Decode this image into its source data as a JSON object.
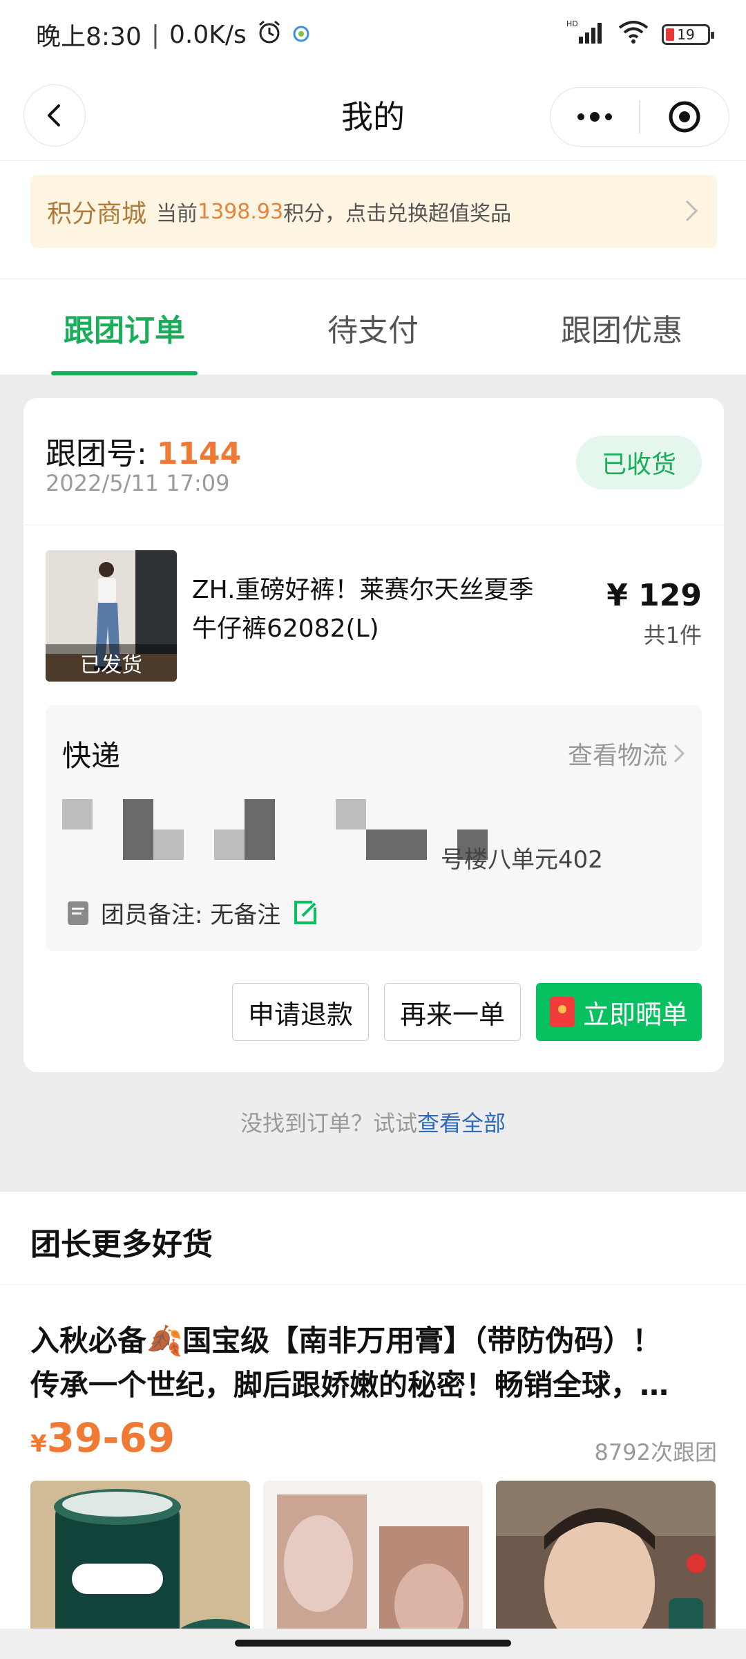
{
  "status_bar": {
    "time": "晚上8:30",
    "speed": "0.0K/s",
    "network": "HD",
    "battery": "19"
  },
  "nav": {
    "title": "我的"
  },
  "points": {
    "title": "积分商城",
    "prefix": "当前",
    "value": "1398.93",
    "suffix": "积分，点击兑换超值奖品"
  },
  "tabs": [
    {
      "label": "跟团订单",
      "active": true
    },
    {
      "label": "待支付",
      "active": false
    },
    {
      "label": "跟团优惠",
      "active": false
    }
  ],
  "order": {
    "group_label": "跟团号:",
    "group_no": "1144",
    "time": "2022/5/11 17:09",
    "status": "已收货",
    "product": {
      "shipped_badge": "已发货",
      "name": "ZH.重磅好裤！莱赛尔天丝夏季牛仔裤62082(L)",
      "price": "¥ 129",
      "quantity": "共1件"
    },
    "express": {
      "title": "快递",
      "logistics_link": "查看物流",
      "address_tail": "号楼八单元402",
      "remark": "团员备注: 无备注"
    },
    "actions": {
      "refund": "申请退款",
      "reorder": "再来一单",
      "share": "立即晒单"
    }
  },
  "footer_hint": {
    "text": "没找到订单？试试",
    "link": "查看全部"
  },
  "more_goods": {
    "title": "团长更多好货",
    "item": {
      "title_line1": "入秋必备🍂国宝级【南非万用膏】（带防伪码）！",
      "title_line2": "传承一个世纪，脚后跟娇嫩的秘密！畅销全球，…",
      "price_symbol": "¥",
      "price": "39-69",
      "count": "8792次跟团"
    }
  },
  "colors": {
    "brand_green": "#07c160",
    "accent_orange": "#f07a33",
    "link_blue": "#2f6bbd"
  }
}
